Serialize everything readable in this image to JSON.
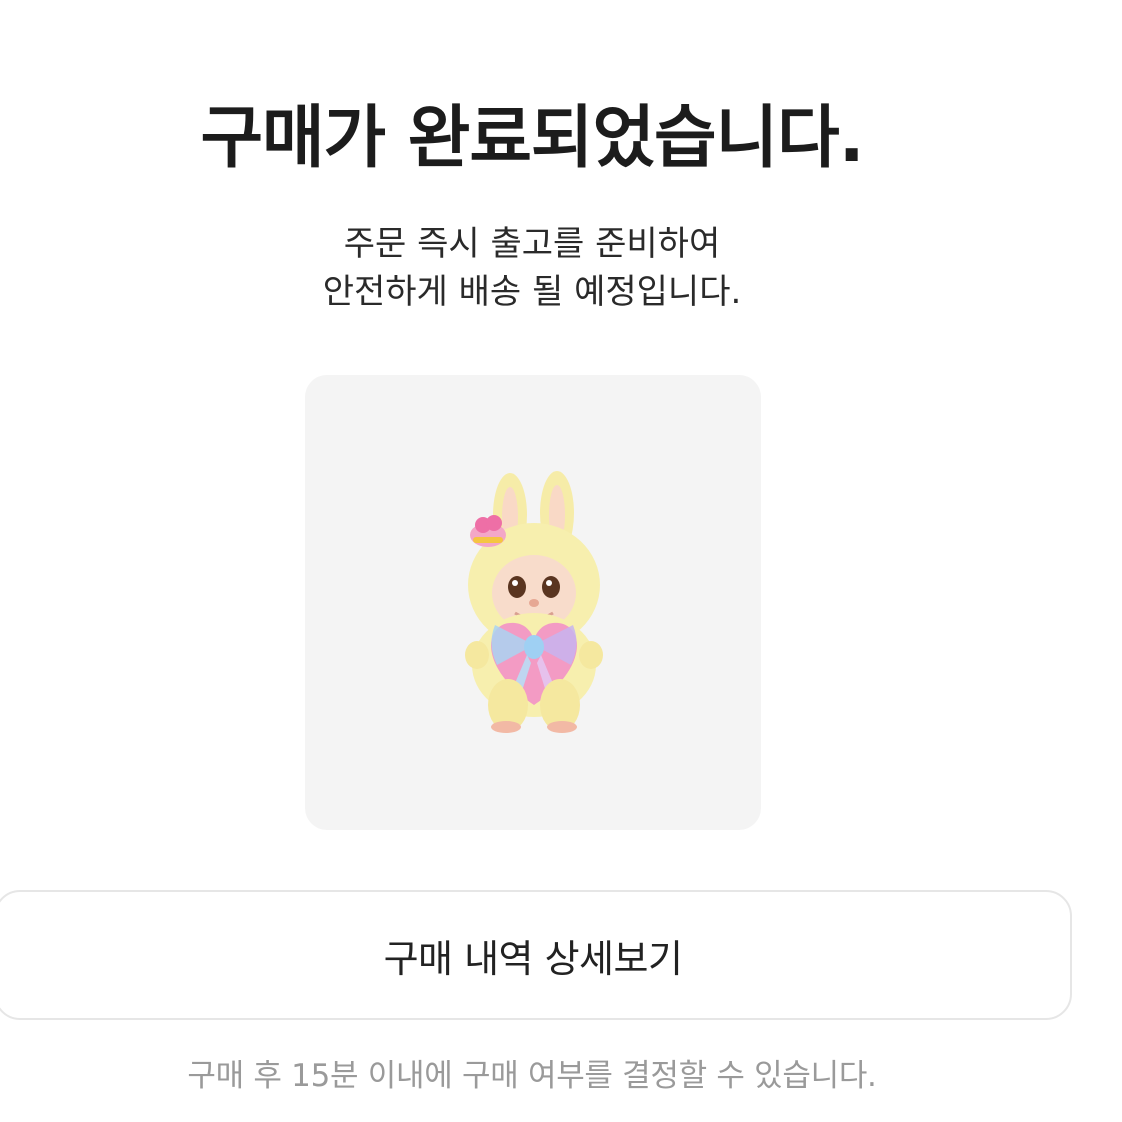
{
  "header": {
    "title": "구매가 완료되었습니다."
  },
  "message": {
    "line1": "주문 즉시 출고를 준비하여",
    "line2": "안전하게 배송 될 예정입니다."
  },
  "product": {
    "image_icon": "plush-doll-figure"
  },
  "actions": {
    "detail_label": "구매 내역 상세보기"
  },
  "footer": {
    "note": "구매 후 15분 이내에 구매 여부를 결정할 수 있습니다."
  },
  "colors": {
    "card_bg": "#f4f4f4",
    "button_border": "#e6e6e6",
    "note_text": "#9a9a9a",
    "title_text": "#1c1c1c"
  }
}
